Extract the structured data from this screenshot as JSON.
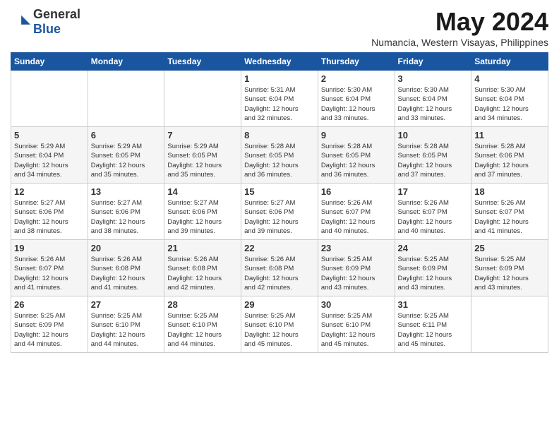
{
  "logo": {
    "general": "General",
    "blue": "Blue"
  },
  "title": "May 2024",
  "location": "Numancia, Western Visayas, Philippines",
  "days_header": [
    "Sunday",
    "Monday",
    "Tuesday",
    "Wednesday",
    "Thursday",
    "Friday",
    "Saturday"
  ],
  "weeks": [
    [
      {
        "day": "",
        "content": ""
      },
      {
        "day": "",
        "content": ""
      },
      {
        "day": "",
        "content": ""
      },
      {
        "day": "1",
        "content": "Sunrise: 5:31 AM\nSunset: 6:04 PM\nDaylight: 12 hours\nand 32 minutes."
      },
      {
        "day": "2",
        "content": "Sunrise: 5:30 AM\nSunset: 6:04 PM\nDaylight: 12 hours\nand 33 minutes."
      },
      {
        "day": "3",
        "content": "Sunrise: 5:30 AM\nSunset: 6:04 PM\nDaylight: 12 hours\nand 33 minutes."
      },
      {
        "day": "4",
        "content": "Sunrise: 5:30 AM\nSunset: 6:04 PM\nDaylight: 12 hours\nand 34 minutes."
      }
    ],
    [
      {
        "day": "5",
        "content": "Sunrise: 5:29 AM\nSunset: 6:04 PM\nDaylight: 12 hours\nand 34 minutes."
      },
      {
        "day": "6",
        "content": "Sunrise: 5:29 AM\nSunset: 6:05 PM\nDaylight: 12 hours\nand 35 minutes."
      },
      {
        "day": "7",
        "content": "Sunrise: 5:29 AM\nSunset: 6:05 PM\nDaylight: 12 hours\nand 35 minutes."
      },
      {
        "day": "8",
        "content": "Sunrise: 5:28 AM\nSunset: 6:05 PM\nDaylight: 12 hours\nand 36 minutes."
      },
      {
        "day": "9",
        "content": "Sunrise: 5:28 AM\nSunset: 6:05 PM\nDaylight: 12 hours\nand 36 minutes."
      },
      {
        "day": "10",
        "content": "Sunrise: 5:28 AM\nSunset: 6:05 PM\nDaylight: 12 hours\nand 37 minutes."
      },
      {
        "day": "11",
        "content": "Sunrise: 5:28 AM\nSunset: 6:06 PM\nDaylight: 12 hours\nand 37 minutes."
      }
    ],
    [
      {
        "day": "12",
        "content": "Sunrise: 5:27 AM\nSunset: 6:06 PM\nDaylight: 12 hours\nand 38 minutes."
      },
      {
        "day": "13",
        "content": "Sunrise: 5:27 AM\nSunset: 6:06 PM\nDaylight: 12 hours\nand 38 minutes."
      },
      {
        "day": "14",
        "content": "Sunrise: 5:27 AM\nSunset: 6:06 PM\nDaylight: 12 hours\nand 39 minutes."
      },
      {
        "day": "15",
        "content": "Sunrise: 5:27 AM\nSunset: 6:06 PM\nDaylight: 12 hours\nand 39 minutes."
      },
      {
        "day": "16",
        "content": "Sunrise: 5:26 AM\nSunset: 6:07 PM\nDaylight: 12 hours\nand 40 minutes."
      },
      {
        "day": "17",
        "content": "Sunrise: 5:26 AM\nSunset: 6:07 PM\nDaylight: 12 hours\nand 40 minutes."
      },
      {
        "day": "18",
        "content": "Sunrise: 5:26 AM\nSunset: 6:07 PM\nDaylight: 12 hours\nand 41 minutes."
      }
    ],
    [
      {
        "day": "19",
        "content": "Sunrise: 5:26 AM\nSunset: 6:07 PM\nDaylight: 12 hours\nand 41 minutes."
      },
      {
        "day": "20",
        "content": "Sunrise: 5:26 AM\nSunset: 6:08 PM\nDaylight: 12 hours\nand 41 minutes."
      },
      {
        "day": "21",
        "content": "Sunrise: 5:26 AM\nSunset: 6:08 PM\nDaylight: 12 hours\nand 42 minutes."
      },
      {
        "day": "22",
        "content": "Sunrise: 5:26 AM\nSunset: 6:08 PM\nDaylight: 12 hours\nand 42 minutes."
      },
      {
        "day": "23",
        "content": "Sunrise: 5:25 AM\nSunset: 6:09 PM\nDaylight: 12 hours\nand 43 minutes."
      },
      {
        "day": "24",
        "content": "Sunrise: 5:25 AM\nSunset: 6:09 PM\nDaylight: 12 hours\nand 43 minutes."
      },
      {
        "day": "25",
        "content": "Sunrise: 5:25 AM\nSunset: 6:09 PM\nDaylight: 12 hours\nand 43 minutes."
      }
    ],
    [
      {
        "day": "26",
        "content": "Sunrise: 5:25 AM\nSunset: 6:09 PM\nDaylight: 12 hours\nand 44 minutes."
      },
      {
        "day": "27",
        "content": "Sunrise: 5:25 AM\nSunset: 6:10 PM\nDaylight: 12 hours\nand 44 minutes."
      },
      {
        "day": "28",
        "content": "Sunrise: 5:25 AM\nSunset: 6:10 PM\nDaylight: 12 hours\nand 44 minutes."
      },
      {
        "day": "29",
        "content": "Sunrise: 5:25 AM\nSunset: 6:10 PM\nDaylight: 12 hours\nand 45 minutes."
      },
      {
        "day": "30",
        "content": "Sunrise: 5:25 AM\nSunset: 6:10 PM\nDaylight: 12 hours\nand 45 minutes."
      },
      {
        "day": "31",
        "content": "Sunrise: 5:25 AM\nSunset: 6:11 PM\nDaylight: 12 hours\nand 45 minutes."
      },
      {
        "day": "",
        "content": ""
      }
    ]
  ]
}
